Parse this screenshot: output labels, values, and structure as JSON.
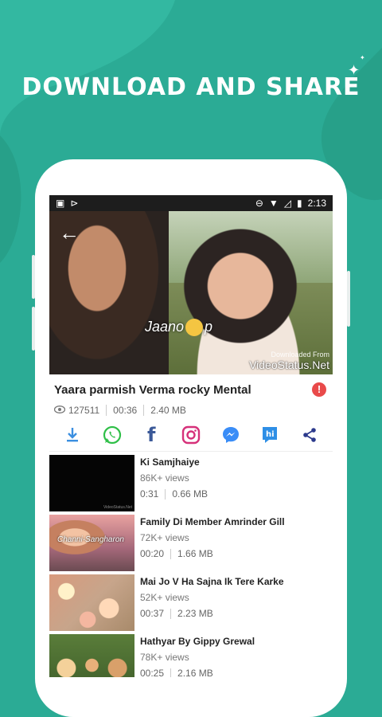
{
  "headline": "DOWNLOAD AND SHARE",
  "status_bar": {
    "time": "2:13"
  },
  "video": {
    "title": "Yaara parmish Verma rocky Mental",
    "views": "127511",
    "duration": "00:36",
    "size": "2.40 MB",
    "overlay_logo_text_left": "Jaano",
    "overlay_logo_text_right": "p",
    "watermark_small": "Downloaded From",
    "watermark_big": "VideoStatus.Net"
  },
  "share_icons": [
    "download-icon",
    "whatsapp-icon",
    "facebook-icon",
    "instagram-icon",
    "messenger-icon",
    "hike-icon",
    "share-icon"
  ],
  "colors": {
    "background": "#2bab95",
    "download": "#3b8fe0",
    "whatsapp": "#2fbf48",
    "facebook": "#3b5998",
    "instagram": "#d6317a",
    "messenger": "#3a8df7",
    "hike": "#2e8fe6",
    "share": "#2c3a8c",
    "report": "#e94a4a"
  },
  "items": [
    {
      "title": "Ki Samjhaiye",
      "views": "86K+ views",
      "duration": "0:31",
      "size": "0.66 MB",
      "thumb_caption": ""
    },
    {
      "title": "Family Di Member Amrinder Gill",
      "views": "72K+ views",
      "duration": "00:20",
      "size": "1.66 MB",
      "thumb_caption": "Channi-Sangharon"
    },
    {
      "title": "Mai Jo V Ha Sajna Ik Tere Karke",
      "views": "52K+ views",
      "duration": "00:37",
      "size": "2.23 MB",
      "thumb_caption": ""
    },
    {
      "title": "Hathyar By Gippy Grewal",
      "views": "78K+ views",
      "duration": "00:25",
      "size": "2.16 MB",
      "thumb_caption": ""
    }
  ]
}
